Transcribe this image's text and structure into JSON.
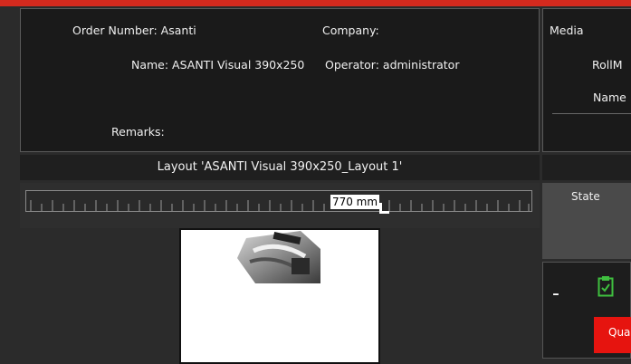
{
  "order": {
    "number_text": "Order Number: Asanti",
    "company_text": "Company:",
    "name_text": "Name: ASANTI Visual 390x250",
    "operator_text": "Operator: administrator",
    "remarks_text": "Remarks:"
  },
  "media": {
    "title": "Media",
    "roll_label": "RollM",
    "name_label": "Name"
  },
  "layout": {
    "title": "Layout 'ASANTI Visual 390x250_Layout 1'"
  },
  "ruler": {
    "value": "770 mm"
  },
  "state": {
    "label": "State"
  },
  "queue": {
    "minus": "-",
    "button_label": "Qua",
    "cut_label": "Q..."
  },
  "colors": {
    "accent_red": "#d42a1e",
    "button_red": "#e6140f",
    "clipboard_green": "#3fbf3f"
  },
  "icons": {
    "clipboard": "clipboard-check-icon",
    "pointer": "ruler-pointer-icon"
  }
}
